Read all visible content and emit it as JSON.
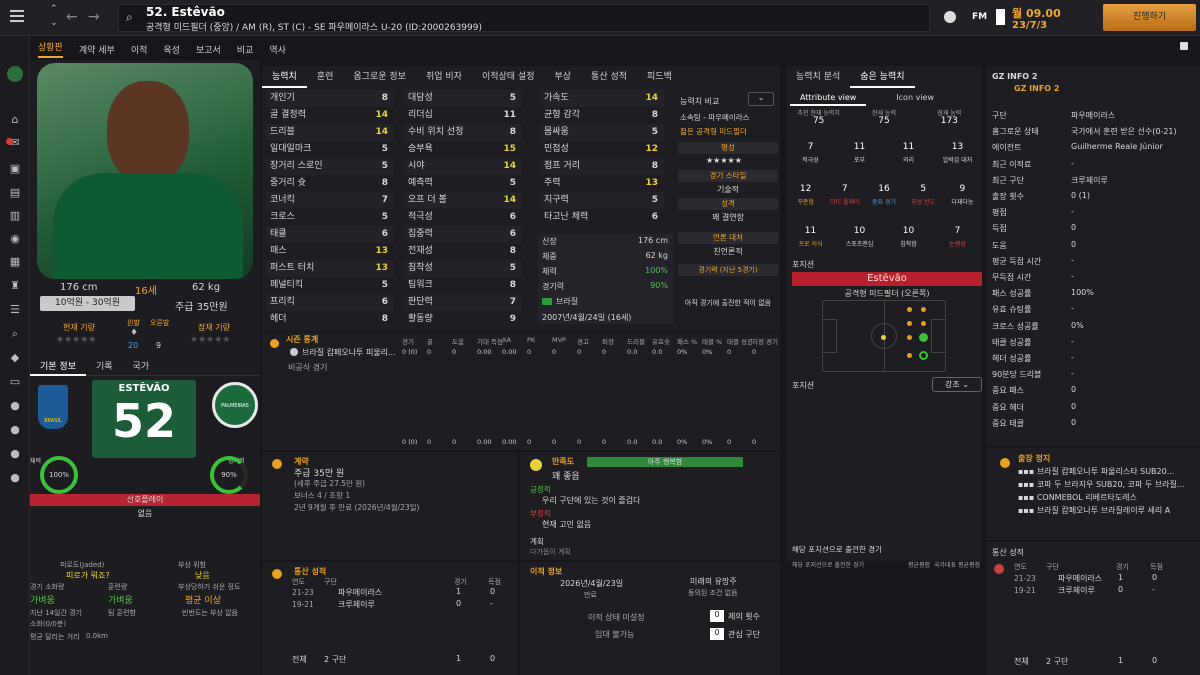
{
  "header": {
    "player_title": "52. Estêvão",
    "player_sub": "공격형 미드필더 (중앙) / AM (R), ST (C) - SE 파우메이라스 U-20 (ID:2000263999)",
    "date_line1": "월 09.00",
    "date_line2": "23/7/3",
    "continue_label": "진행하기",
    "fm_label": "FM"
  },
  "subnav": [
    "상황판",
    "계약 세부",
    "이적",
    "육성",
    "보고서",
    "비교",
    "역사"
  ],
  "profile": {
    "height": "176 cm",
    "age": "16세",
    "weight": "62 kg",
    "value": "10억원 - 30억원",
    "wage": "주급 35만원",
    "cur_ability_label": "현재 기량",
    "pot_ability_label": "잠재 기량",
    "left_foot_label": "왼발",
    "right_foot_label": "오른발",
    "left_foot": "20",
    "right_foot": "9",
    "tabs": [
      "기본 정보",
      "기록",
      "국가"
    ],
    "shirt_name": "ESTÊVÃO",
    "shirt_number": "52",
    "cond_label": "체력",
    "cond_val": "100%",
    "match_label": "경기력",
    "match_val": "90%",
    "preferred": "선호플레이",
    "preferred_val": "없음",
    "brazil_text": "BRASIL",
    "palmeiras_text": "PALMEIRAS"
  },
  "bottom_left": {
    "l1": "피로도(Jaded)",
    "l1b": "피로가 뭐죠?",
    "r1": "부상 위험",
    "r1b": "낮음",
    "l2": "경기 소화량",
    "l2b": "가벼움",
    "m2": "훈련량",
    "m2b": "가벼움",
    "r2": "부상당하기 쉬운 정도",
    "r2b": "평균 이상",
    "l3": "지난 14일간 경기",
    "l3b": "소화(0/0분)",
    "m3": "팀 훈련함",
    "r3": "빈번도는 부상 없음",
    "l4": "평균 달리는 거리",
    "l4b": "0.0km"
  },
  "attr_tabs": [
    "능력치",
    "훈련",
    "옴그로운 정보",
    "취업 비자",
    "이적상태 설정",
    "부상",
    "통산 성적",
    "피드백"
  ],
  "attrs_col1": [
    [
      "개인기",
      "8",
      ""
    ],
    [
      "골 결정력",
      "14",
      "y"
    ],
    [
      "드리블",
      "14",
      "y"
    ],
    [
      "일대일마크",
      "5",
      ""
    ],
    [
      "장거리 스로인",
      "5",
      ""
    ],
    [
      "중거리 슛",
      "8",
      ""
    ],
    [
      "코너킥",
      "7",
      ""
    ],
    [
      "크로스",
      "5",
      ""
    ],
    [
      "태클",
      "6",
      ""
    ],
    [
      "패스",
      "13",
      "y"
    ],
    [
      "퍼스트 터치",
      "13",
      "y"
    ],
    [
      "페널티킥",
      "5",
      ""
    ],
    [
      "프리킥",
      "6",
      ""
    ],
    [
      "헤더",
      "8",
      ""
    ]
  ],
  "attrs_col2": [
    [
      "대담성",
      "5",
      ""
    ],
    [
      "리더십",
      "11",
      ""
    ],
    [
      "수비 위치 선정",
      "8",
      ""
    ],
    [
      "승부욕",
      "15",
      "y"
    ],
    [
      "시야",
      "14",
      "y"
    ],
    [
      "예측력",
      "5",
      ""
    ],
    [
      "오프 더 볼",
      "14",
      "y"
    ],
    [
      "적극성",
      "6",
      ""
    ],
    [
      "집중력",
      "6",
      ""
    ],
    [
      "전재성",
      "8",
      ""
    ],
    [
      "침착성",
      "5",
      ""
    ],
    [
      "팀워크",
      "8",
      ""
    ],
    [
      "판단력",
      "7",
      ""
    ],
    [
      "활동량",
      "9",
      ""
    ]
  ],
  "attrs_col3": [
    [
      "가속도",
      "14",
      "y"
    ],
    [
      "균형 감각",
      "8",
      ""
    ],
    [
      "몸싸움",
      "5",
      ""
    ],
    [
      "민첩성",
      "12",
      "y"
    ],
    [
      "점프 거리",
      "8",
      ""
    ],
    [
      "주력",
      "13",
      "y"
    ],
    [
      "지구력",
      "5",
      ""
    ],
    [
      "타고난 체력",
      "6",
      ""
    ]
  ],
  "phys": [
    [
      "신장",
      "176 cm"
    ],
    [
      "체중",
      "62 kg"
    ],
    [
      "체력",
      "100%"
    ],
    [
      "경기력",
      "90%"
    ],
    [
      "국적",
      "브라질"
    ]
  ],
  "dob": "2007년/4월/24일 (16세)",
  "mini": {
    "compare": "능력치 비교",
    "club": "소속팀 - 파우메이라스",
    "role": "젊은 공격형 미드필더",
    "rep": "명성",
    "style": "경기 스타일",
    "style_val": "기술적",
    "personality": "성격",
    "personality_val": "꽤 결연함",
    "media": "언론 대처",
    "media_val": "친언론적",
    "form": "경기력 (지난 5경기)",
    "form_val": "아직 경기에 출전한 적이 없음"
  },
  "season": {
    "title": "시즌 통계",
    "cols": [
      "경기",
      "골",
      "도움",
      "기대 득점",
      "XA",
      "PK",
      "MVP",
      "경고",
      "퇴장",
      "드리블",
      "유효슛",
      "패스 %",
      "태클 %",
      "태클 성공",
      "지정 경기"
    ],
    "comp": "브라질 캄페오나투 피울리...",
    "comp_vals": [
      "0 (0)",
      "0",
      "0",
      "0.00",
      "0.00",
      "0",
      "0",
      "0",
      "0",
      "0.0",
      "0.0",
      "0%",
      "0%",
      "0",
      "0"
    ],
    "other": "비공식 경기",
    "total_vals": [
      "0 (0)",
      "0",
      "0",
      "0.00",
      "0.00",
      "0",
      "0",
      "0",
      "0",
      "0.0",
      "0.0",
      "0%",
      "0%",
      "0",
      "0"
    ]
  },
  "contract": {
    "title": "계약",
    "l1": "주급 35만 원",
    "l2": "(세후 주급 27.5만 원)",
    "l3": "보너스 4 / 조항 1",
    "l4": "2년 9개월 후 만료 (2026년/4월/23일)"
  },
  "happy": {
    "title": "만족도",
    "status": "아주 행복함",
    "level": "꽤 좋음",
    "pos_title": "긍정적",
    "pos1": "우리 구단에 있는 것이 즐겁다",
    "neg_title": "부정적",
    "neg1": "현재 고민 없음",
    "plan_title": "계획",
    "plan": "다가옵이 계획"
  },
  "career": {
    "title": "통산 성적",
    "cols": [
      "연도",
      "구단",
      "경기",
      "득점"
    ],
    "rows": [
      [
        "21-23",
        "파우메이라스",
        "1",
        "0"
      ],
      [
        "19-21",
        "크루제이루",
        "0",
        "-"
      ]
    ],
    "total_label": "전체",
    "total_clubs": "2 구단",
    "total_apps": "1",
    "total_goals": "0"
  },
  "transfer": {
    "title": "이적 정보",
    "date": "2026년/4월/23일",
    "date_label": "만료",
    "future": "미래의 유망주",
    "future_sub": "동의된 조건 없음",
    "status_label": "이적 상태 미설정",
    "loan_label": "임대 불가능",
    "offers_label": "제의 횟수",
    "offers_val": "0",
    "interest_label": "관심 구단",
    "interest_val": "0"
  },
  "right_mid": {
    "tabs": [
      "능력치 분석",
      "숨은 능력치"
    ],
    "subtabs": [
      "Attribute view",
      "Icon view"
    ],
    "top": [
      [
        "추천 현재 능력치",
        "75"
      ],
      [
        "현재 능력",
        "75"
      ],
      [
        "잠재 능력",
        "173"
      ]
    ],
    "row1": [
      [
        "적극성",
        "7",
        ""
      ],
      [
        "포부",
        "11",
        ""
      ],
      [
        "의리",
        "11",
        ""
      ],
      [
        "압박감 대처",
        "13",
        ""
      ]
    ],
    "row2": [
      [
        "꾸준함",
        "12",
        "o"
      ],
      [
        "더티 플레이",
        "7",
        "r"
      ],
      [
        "중요 경기",
        "16",
        "b"
      ],
      [
        "부상 빈도",
        "5",
        "r"
      ],
      [
        "다재다능",
        "9",
        ""
      ]
    ],
    "row3": [
      [
        "프로 의식",
        "11",
        "o"
      ],
      [
        "스포츠맨십",
        "10",
        ""
      ],
      [
        "침착함",
        "10",
        ""
      ],
      [
        "논쟁성",
        "7",
        "r"
      ]
    ],
    "pos_label": "포지션",
    "name": "Estêvão",
    "position": "공격형 미드필더 (오른쪽)",
    "pos2_label": "포지션",
    "highlight": "강조",
    "appeared": "해당 포지션으로 출전한 경기",
    "cols": [
      "해당 포지션으로 출전한 경기",
      "평균평점",
      "국가대표 평균평점"
    ]
  },
  "gz": {
    "title": "GZ INFO 2",
    "sub": "GZ INFO 2",
    "rows": [
      [
        "구단",
        "파우메이라스"
      ],
      [
        "홈그로운 상태",
        "국가에서 훈련 받은 선수(0-21)"
      ],
      [
        "에이전트",
        "Guilherme Reale Júnior"
      ],
      [
        "최근 이적료",
        "-"
      ],
      [
        "최근 구단",
        "크루제이루"
      ],
      [
        "출장 횟수",
        "0 (1)"
      ],
      [
        "평점",
        "-"
      ],
      [
        "득점",
        "0"
      ],
      [
        "도움",
        "0"
      ],
      [
        "평균 득점 시간",
        "-"
      ],
      [
        "무득점 시간",
        "-"
      ],
      [
        "패스 성공률",
        "100%"
      ],
      [
        "유효 슈팅률",
        "-"
      ],
      [
        "크로스 성공률",
        "0%"
      ],
      [
        "태클 성공률",
        "-"
      ],
      [
        "헤더 성공률",
        "-"
      ],
      [
        "90분당 드리블",
        "-"
      ],
      [
        "중요 패스",
        "0"
      ],
      [
        "중요 헤더",
        "0"
      ],
      [
        "중요 태클",
        "0"
      ]
    ],
    "ban_title": "출장 정지",
    "bans": [
      "브라질 캄페오나투 파울리스타 SUB20...",
      "코파 두 브라지우 SUB20, 코파 두 브라질...",
      "CONMEBOL 리베르타도레스",
      "브라질 캄페오나투 브라질레이루 세리 A"
    ],
    "career_title": "통산 성적",
    "career_cols": [
      "연도",
      "구단",
      "경기",
      "득점"
    ],
    "career_rows": [
      [
        "21-23",
        "파우메이라스",
        "1",
        "0"
      ],
      [
        "19-21",
        "크루제이루",
        "0",
        "-"
      ]
    ],
    "total_label": "전체",
    "total_clubs": "2 구단",
    "total_apps": "1",
    "total_goals": "0"
  },
  "colors": {
    "accent": "#e8a020",
    "green": "#3bb73b",
    "red": "#b7212c",
    "yellow": "#e6d23a"
  }
}
